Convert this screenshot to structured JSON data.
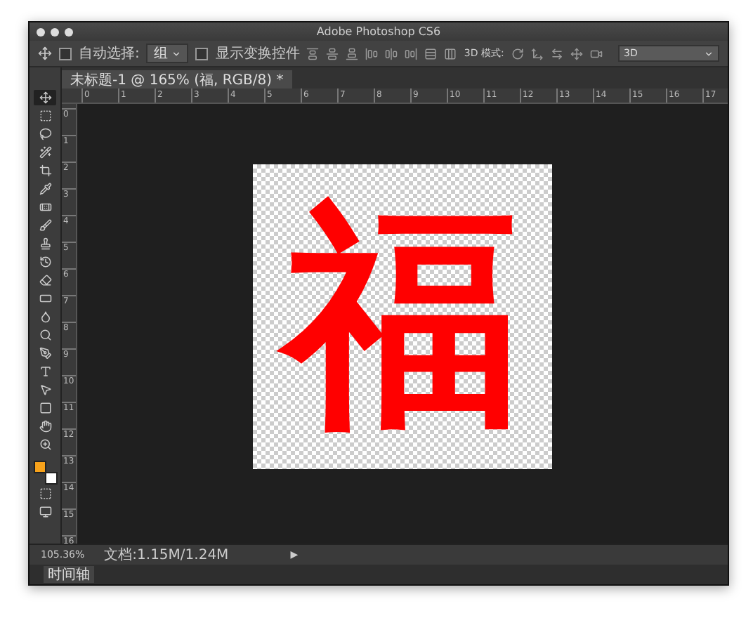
{
  "window": {
    "title": "Adobe Photoshop CS6"
  },
  "options_bar": {
    "auto_select": {
      "label": "自动选择:",
      "checked": false,
      "value": "组"
    },
    "show_transform": {
      "label": "显示变换控件",
      "checked": false
    },
    "mode_3d_label": "3D 模式:",
    "workspace": "3D"
  },
  "document_tab": {
    "title": "未标题-1 @ 165% (福, RGB/8) *"
  },
  "ruler": {
    "horizontal": [
      "0",
      "1",
      "2",
      "3",
      "4",
      "5",
      "6",
      "7",
      "8",
      "9",
      "10",
      "11",
      "12",
      "13",
      "14",
      "15",
      "16",
      "17"
    ],
    "vertical": [
      "0",
      "1",
      "2",
      "3",
      "4",
      "5",
      "6",
      "7",
      "8",
      "9",
      "10",
      "11",
      "12",
      "13",
      "14",
      "15",
      "16"
    ]
  },
  "tools": [
    {
      "kind": "move",
      "selected": true
    },
    {
      "kind": "marquee",
      "selected": false
    },
    {
      "kind": "lasso",
      "selected": false
    },
    {
      "kind": "wand",
      "selected": false
    },
    {
      "kind": "crop",
      "selected": false
    },
    {
      "kind": "eyedropper",
      "selected": false
    },
    {
      "kind": "healing",
      "selected": false
    },
    {
      "kind": "brush",
      "selected": false
    },
    {
      "kind": "stamp",
      "selected": false
    },
    {
      "kind": "history",
      "selected": false
    },
    {
      "kind": "eraser",
      "selected": false
    },
    {
      "kind": "gradient",
      "selected": false
    },
    {
      "kind": "blur",
      "selected": false
    },
    {
      "kind": "dodge",
      "selected": false
    },
    {
      "kind": "pen",
      "selected": false
    },
    {
      "kind": "type",
      "selected": false
    },
    {
      "kind": "path",
      "selected": false
    },
    {
      "kind": "shape",
      "selected": false
    },
    {
      "kind": "hand",
      "selected": false
    },
    {
      "kind": "zoom",
      "selected": false
    }
  ],
  "swatches": [
    {
      "color": "#f7a21b"
    },
    {
      "color": "#ffffff"
    }
  ],
  "canvas": {
    "artwork_text": "福"
  },
  "status_bar": {
    "zoom": "105.36%",
    "doc_info": "文档:1.15M/1.24M",
    "arrow": "▶"
  },
  "panel_tab": "时间轴"
}
